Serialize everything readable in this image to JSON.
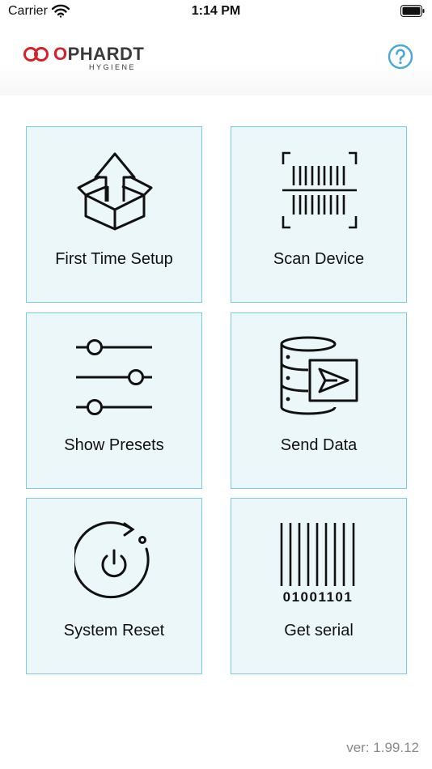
{
  "status_bar": {
    "carrier": "Carrier",
    "time": "1:14 PM",
    "wifi_icon": "wifi-icon",
    "battery_icon": "battery-icon"
  },
  "header": {
    "logo_o": "O",
    "logo_rest": "PHARDT",
    "logo_sub": "HYGIENE",
    "help_icon": "question-circle-icon",
    "accent_color": "#4aa8d8",
    "brand_red": "#d6202a"
  },
  "tiles": [
    {
      "label": "First Time Setup",
      "icon": "box-upload-icon"
    },
    {
      "label": "Scan Device",
      "icon": "barcode-scan-icon"
    },
    {
      "label": "Show Presets",
      "icon": "sliders-icon"
    },
    {
      "label": "Send Data",
      "icon": "database-send-icon"
    },
    {
      "label": "System Reset",
      "icon": "power-reset-icon"
    },
    {
      "label": "Get serial",
      "icon": "barcode-serial-icon",
      "serial_digits": "01001101"
    }
  ],
  "footer": {
    "version": "ver: 1.99.12"
  }
}
